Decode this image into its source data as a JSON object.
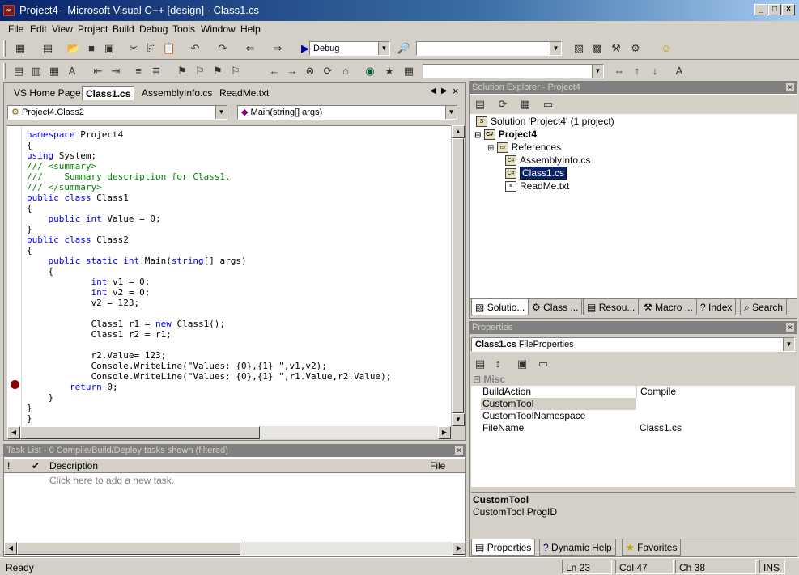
{
  "window": {
    "title": "Project4 - Microsoft Visual C++ [design] - Class1.cs",
    "icon_text": "∞"
  },
  "menu": [
    "File",
    "Edit",
    "View",
    "Project",
    "Build",
    "Debug",
    "Tools",
    "Window",
    "Help"
  ],
  "toolbar": {
    "config_value": "Debug",
    "platform_value": "",
    "find_value": ""
  },
  "editor": {
    "tabs": [
      "VS Home Page",
      "Class1.cs",
      "AssemblyInfo.cs",
      "ReadMe.txt"
    ],
    "active_tab": "Class1.cs",
    "class_combo": "Project4.Class2",
    "member_combo": "Main(string[] args)",
    "code_lines": [
      "namespace Project4",
      "{",
      "using System;",
      "/// <summary>",
      "///    Summary description for Class1.",
      "/// </summary>",
      "public class Class1",
      "{",
      "    public int Value = 0;",
      "}",
      "public class Class2",
      "{",
      "    public static int Main(string[] args)",
      "    {",
      "            int v1 = 0;",
      "            int v2 = 0;",
      "            v2 = 123;",
      "",
      "            Class1 r1 = new Class1();",
      "            Class1 r2 = r1;",
      "",
      "            r2.Value= 123;",
      "            Console.WriteLine(\"Values: {0},{1} \",v1,v2);",
      "            Console.WriteLine(\"Values: {0},{1} \",r1.Value,r2.Value);",
      "        return 0;",
      "    }",
      "}",
      "}"
    ],
    "breakpoint_line": 25
  },
  "tasklist": {
    "title": "Task List - 0 Compile/Build/Deploy tasks shown (filtered)",
    "columns": [
      "!",
      "✔",
      "Description",
      "File"
    ],
    "placeholder": "Click here to add a new task."
  },
  "solution_explorer": {
    "title": "Solution Explorer - Project4",
    "solution": "Solution 'Project4' (1 project)",
    "project": "Project4",
    "items": [
      "References",
      "AssemblyInfo.cs",
      "Class1.cs",
      "ReadMe.txt"
    ],
    "selected": "Class1.cs",
    "tabs": [
      "Solutio...",
      "Class ...",
      "Resou...",
      "Macro ...",
      "Index",
      "Search"
    ]
  },
  "properties": {
    "title": "Properties",
    "object_name": "Class1.cs",
    "object_type": "FileProperties",
    "category": "Misc",
    "rows": [
      {
        "name": "BuildAction",
        "value": "Compile"
      },
      {
        "name": "CustomTool",
        "value": ""
      },
      {
        "name": "CustomToolNamespace",
        "value": ""
      },
      {
        "name": "FileName",
        "value": "Class1.cs"
      }
    ],
    "desc_title": "CustomTool",
    "desc_text": "CustomTool ProgID",
    "bottom_tabs": [
      "Properties",
      "Dynamic Help",
      "Favorites"
    ]
  },
  "status": {
    "text": "Ready",
    "line": "Ln 23",
    "col": "Col 47",
    "ch": "Ch 38",
    "mode": "INS"
  }
}
